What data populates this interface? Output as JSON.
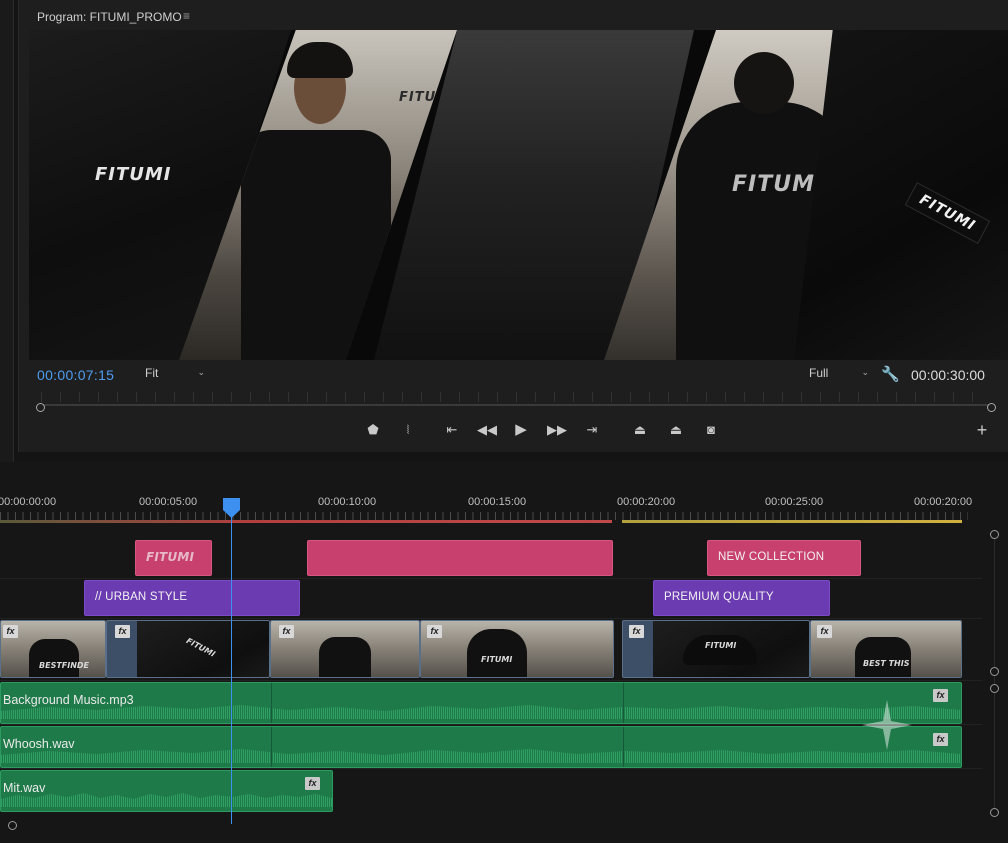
{
  "monitor": {
    "title": "Program: FITUMI_PROMO",
    "menu_icon": "hamburger-menu-icon",
    "current_timecode": "00:00:07:15",
    "fit_option": "Fit",
    "quality_option": "Full",
    "duration_timecode": "00:00:30:00",
    "settings_icon": "wrench-icon",
    "preview_texts": [
      "FITUMI",
      "FITUMI",
      "FITUMI",
      "FITUMI"
    ]
  },
  "transport": {
    "buttons": [
      {
        "name": "add-marker",
        "icon": "marker-icon"
      },
      {
        "name": "mark-in-out",
        "icon": "in-out-icon"
      },
      {
        "name": "go-to-in",
        "icon": "step-back-icon"
      },
      {
        "name": "step-back",
        "icon": "rewind-icon"
      },
      {
        "name": "play",
        "icon": "play-icon"
      },
      {
        "name": "step-forward",
        "icon": "forward-icon"
      },
      {
        "name": "go-to-out",
        "icon": "step-forward-icon"
      },
      {
        "name": "lift",
        "icon": "lift-icon"
      },
      {
        "name": "extract",
        "icon": "extract-icon"
      },
      {
        "name": "export-frame",
        "icon": "camera-icon"
      }
    ],
    "add_icon": "plus-icon"
  },
  "timeline": {
    "ruler": [
      "00:00:00:00",
      "00:00:05:00",
      "00:00:10:00",
      "00:00:15:00",
      "00:00:20:00",
      "00:00:25:00",
      "00:00:20:00"
    ],
    "title_clips": {
      "fitumi_logo": "FITUMI",
      "new_collection": "NEW COLLECTION",
      "urban_style": "// URBAN STYLE",
      "premium_quality": "PREMIUM QUALITY"
    },
    "video_clip_texts": [
      "BESTFINDE",
      "FITUMI",
      "FITUMI",
      "FITUMI",
      "BEST THIS"
    ],
    "fx_label": "fx",
    "audio": {
      "music": "Background Music.mp3",
      "whoosh": "Whoosh.wav",
      "mit": "Mit.wav"
    }
  },
  "colors": {
    "accent_blue": "#3d8ff0",
    "title_pink": "#c8406e",
    "title_purple": "#6b3bb2",
    "audio_green": "#1f7a4a",
    "video_blue": "#5a6f88"
  }
}
